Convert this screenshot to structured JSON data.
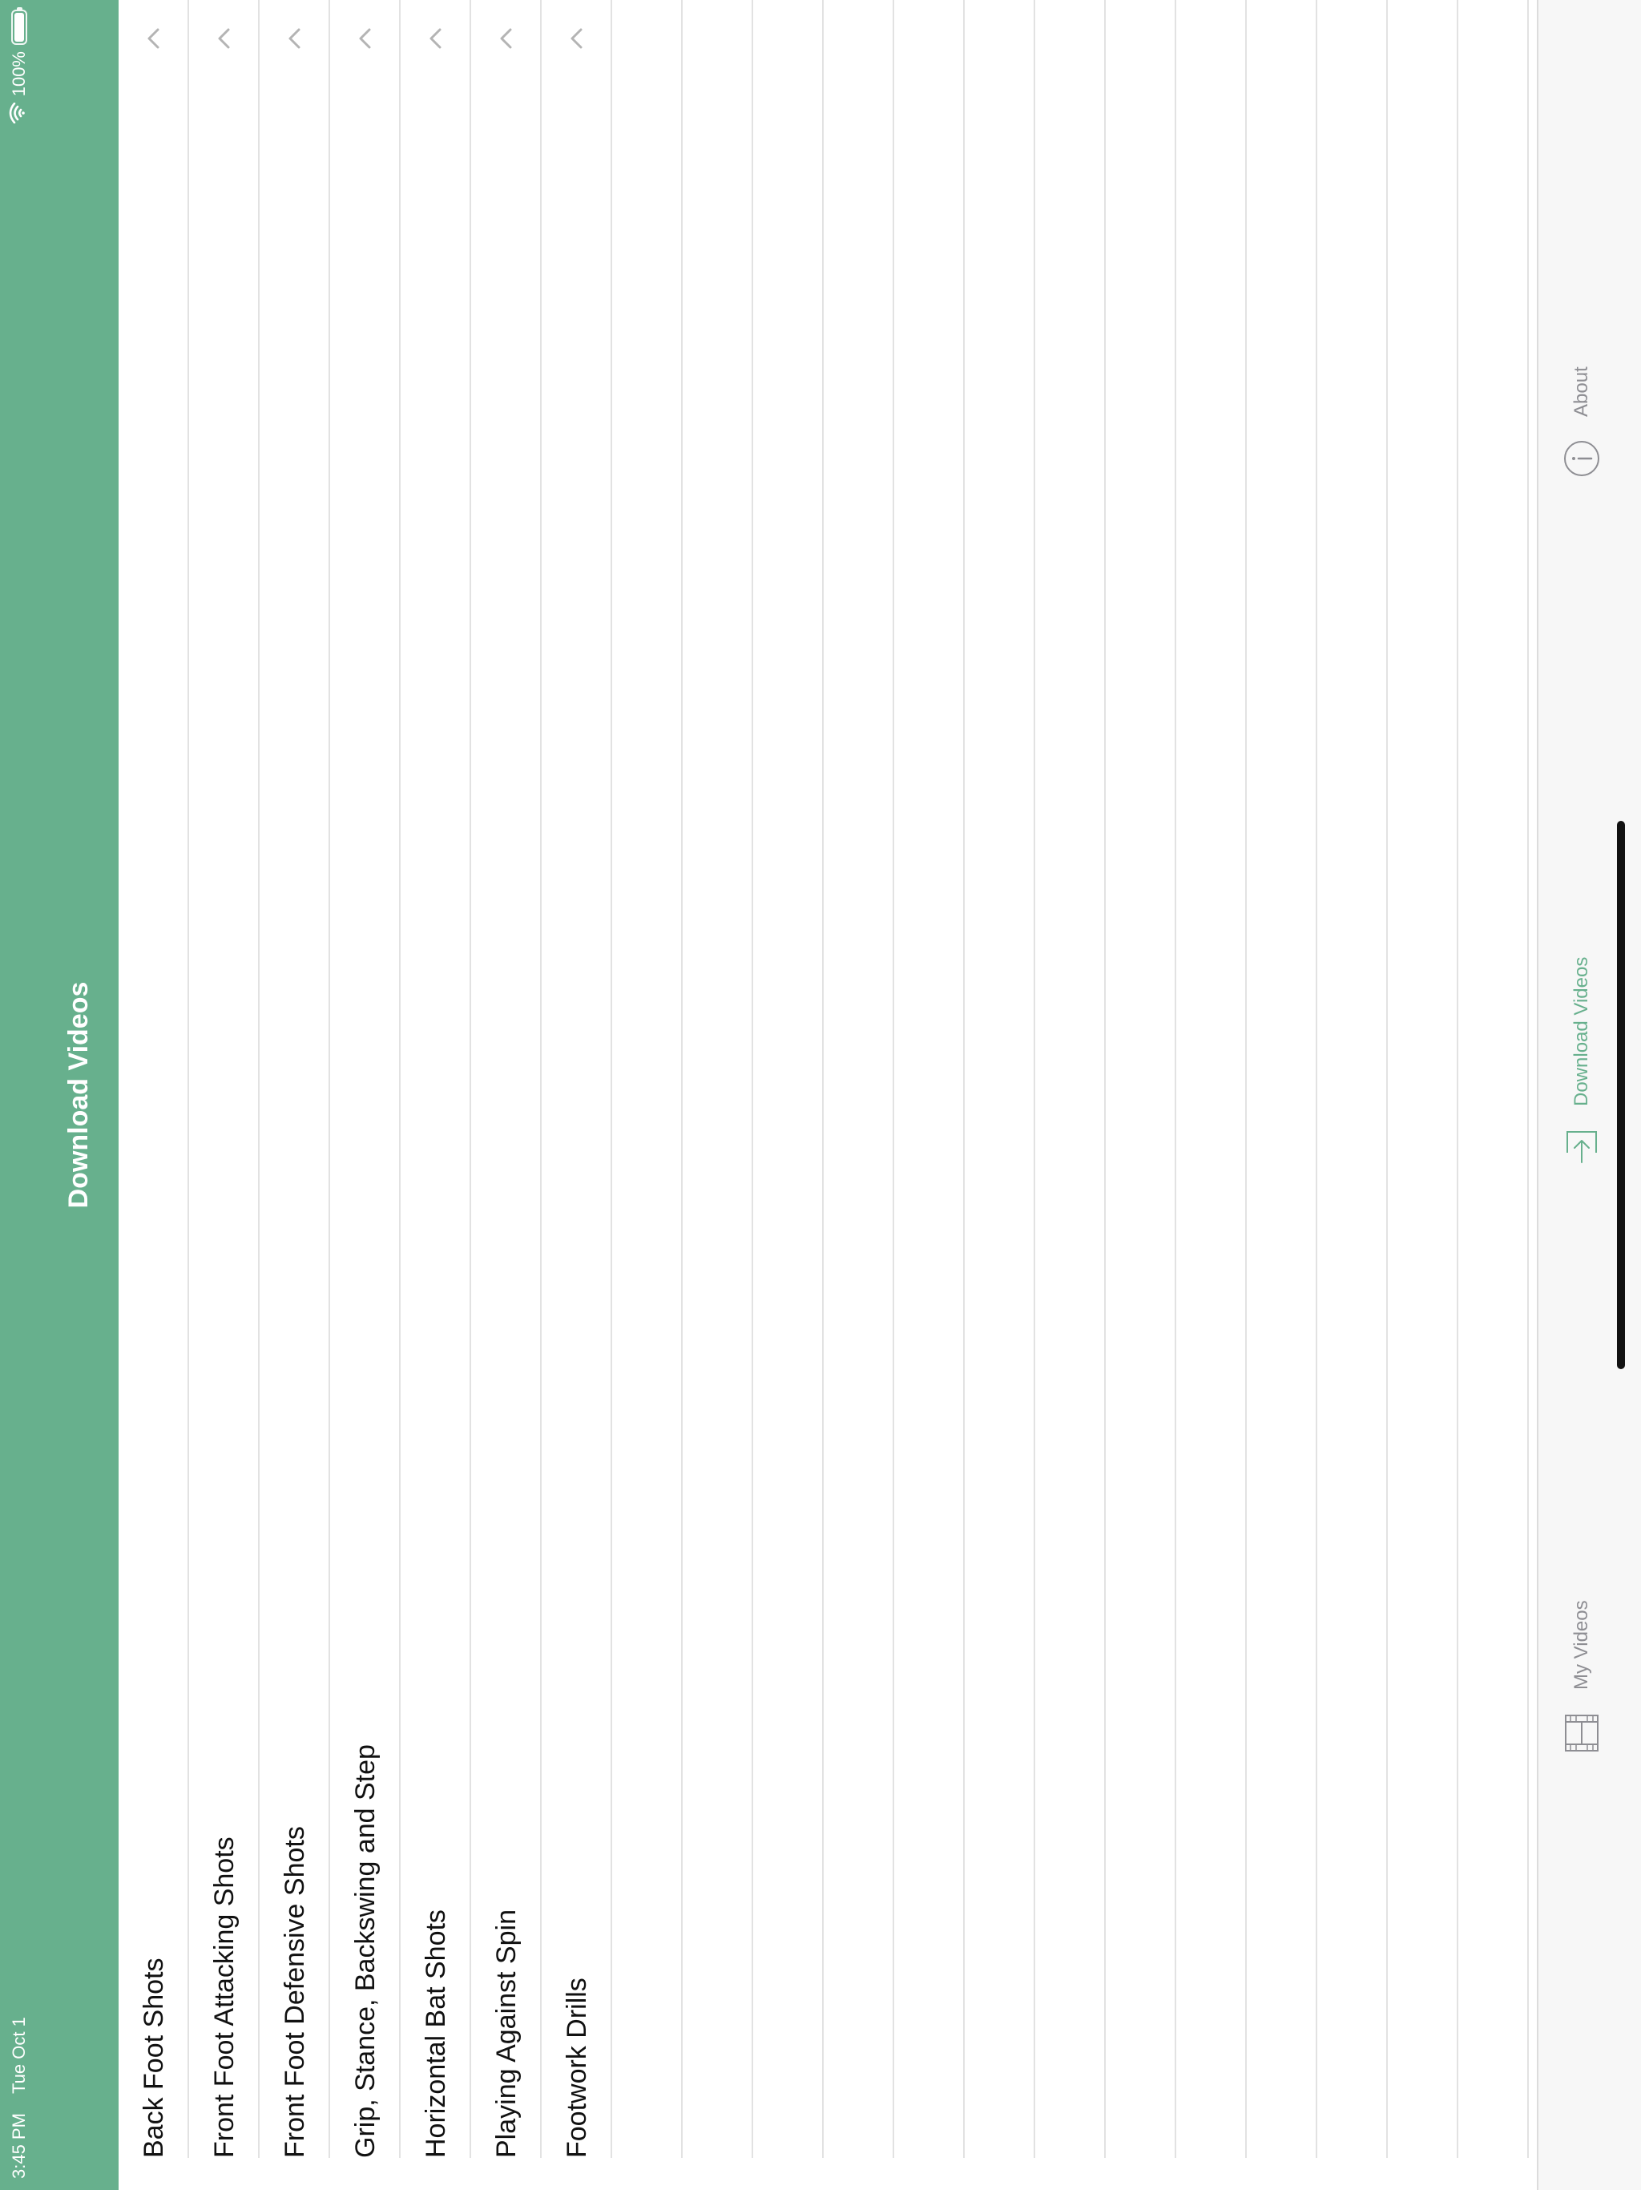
{
  "status_bar": {
    "time": "3:45 PM",
    "date": "Tue Oct 1",
    "battery": "100%",
    "battery_level": 1.0
  },
  "header": {
    "title": "Download Videos"
  },
  "categories": [
    {
      "label": "Back Foot Shots",
      "icon": "chevron-up-icon"
    },
    {
      "label": "Front Foot Attacking Shots",
      "icon": "chevron-up-icon"
    },
    {
      "label": "Front Foot Defensive Shots",
      "icon": "chevron-up-icon"
    },
    {
      "label": "Grip, Stance, Backswing and Step",
      "icon": "chevron-up-icon"
    },
    {
      "label": "Horizontal Bat Shots",
      "icon": "chevron-up-icon"
    },
    {
      "label": "Playing Against Spin",
      "icon": "chevron-up-icon"
    },
    {
      "label": "Footwork Drills",
      "icon": "chevron-up-icon"
    }
  ],
  "tabs": [
    {
      "label": "My Videos",
      "icon": "film-icon",
      "active": false
    },
    {
      "label": "Download Videos",
      "icon": "download-icon",
      "active": true
    },
    {
      "label": "About",
      "icon": "info-icon",
      "active": false
    }
  ],
  "colors": {
    "accent": "#67b08d",
    "inactive_tab": "#8e8e93",
    "separator": "#e2e2e2"
  }
}
